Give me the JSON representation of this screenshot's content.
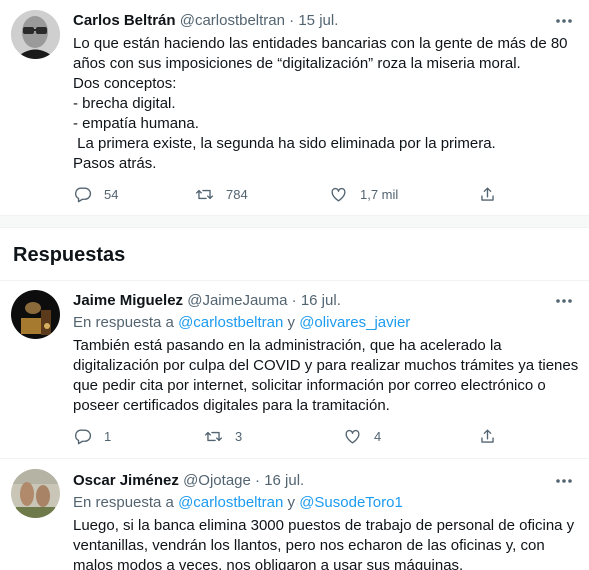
{
  "main_tweet": {
    "author_name": "Carlos Beltrán",
    "handle": "@carlostbeltran",
    "separator": "·",
    "date": "15 jul.",
    "lines": [
      "Lo que están haciendo las entidades bancarias con la gente de más de 80",
      "años con sus imposiciones de “digitalización” roza la miseria moral.",
      "Dos conceptos:",
      "- brecha digital.",
      "- empatía humana.",
      " La primera existe, la segunda ha sido eliminada por la primera.",
      "Pasos atrás."
    ],
    "replies": "54",
    "retweets": "784",
    "likes": "1,7 mil"
  },
  "section": {
    "title": "Respuestas"
  },
  "replies": [
    {
      "author_name": "Jaime Miguelez",
      "handle": "@JaimeJauma",
      "separator": "·",
      "date": "16 jul.",
      "reply_prefix": "En respuesta a",
      "reply_user_1": "@carlostbeltran",
      "reply_and": "y",
      "reply_user_2": "@olivares_javier",
      "lines": [
        "También está pasando en la administración, que ha acelerado la",
        "digitalización por culpa del COVID y para realizar muchos trámites ya tienes",
        "que pedir cita por internet, solicitar información por correo electrónico o",
        "poseer certificados digitales para la tramitación."
      ],
      "replies": "1",
      "retweets": "3",
      "likes": "4"
    },
    {
      "author_name": "Oscar Jiménez",
      "handle": "@Ojotage",
      "separator": "·",
      "date": "16 jul.",
      "reply_prefix": "En respuesta a",
      "reply_user_1": "@carlostbeltran",
      "reply_and": "y",
      "reply_user_2": "@SusodeToro1",
      "lines": [
        "Luego, si la banca elimina 3000 puestos de trabajo de personal de oficina y",
        "ventanillas, vendrán los llantos, pero nos echaron de las oficinas y, con",
        "malos modos a veces, nos obligaron a usar sus máquinas."
      ]
    }
  ],
  "colors": {
    "accent": "#1d9bf0",
    "muted": "#536471",
    "text": "#0f1419"
  }
}
